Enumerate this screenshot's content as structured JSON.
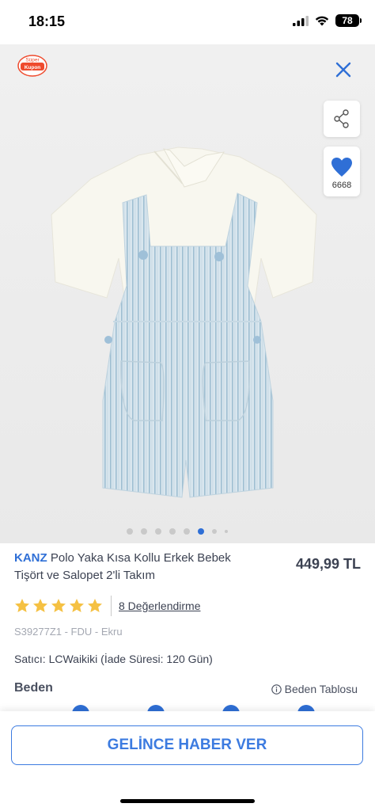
{
  "status_bar": {
    "time": "18:15",
    "battery": "78"
  },
  "badge": {
    "line1": "Süper",
    "line2": "Kupon"
  },
  "favorite": {
    "count": "6668"
  },
  "carousel": {
    "total": 8,
    "active_index": 5
  },
  "product": {
    "brand": "KANZ",
    "name": "Polo Yaka Kısa Kollu Erkek Bebek Tişört ve Salopet 2'li Takım",
    "price": "449,99 TL",
    "rating": 5,
    "reviews_label": "8 Değerlendirme",
    "sku": "S39277Z1 - FDU - Ekru",
    "seller": "Satıcı: LCWaikiki (İade Süresi: 120 Gün)"
  },
  "size_section": {
    "label": "Beden",
    "chart_label": "Beden Tablosu"
  },
  "cta": {
    "label": "GELİNCE HABER VER"
  },
  "colors": {
    "accent": "#2f6fd6",
    "star": "#f5c143",
    "button_border": "#3c7be0"
  }
}
